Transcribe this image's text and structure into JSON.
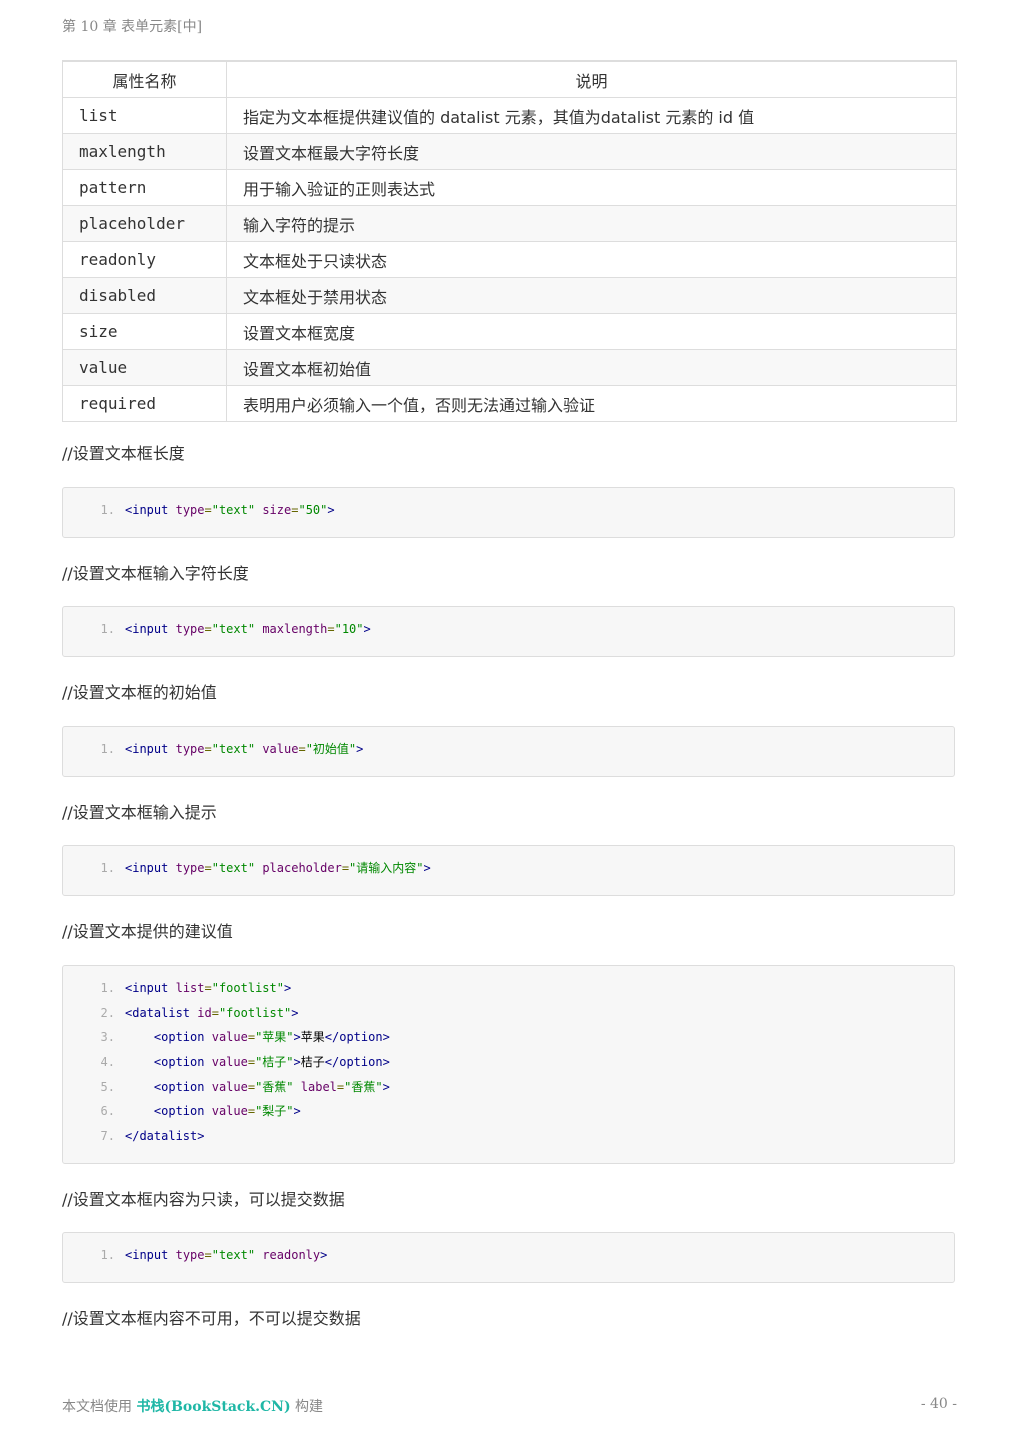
{
  "header": "第 10 章 表单元素[中]",
  "table": {
    "headers": [
      "属性名称",
      "说明"
    ],
    "rows": [
      [
        "list",
        "指定为文本框提供建议值的 datalist 元素，其值为datalist 元素的 id 值"
      ],
      [
        "maxlength",
        "设置文本框最大字符长度"
      ],
      [
        "pattern",
        "用于输入验证的正则表达式"
      ],
      [
        "placeholder",
        "输入字符的提示"
      ],
      [
        "readonly",
        "文本框处于只读状态"
      ],
      [
        "disabled",
        "文本框处于禁用状态"
      ],
      [
        "size",
        "设置文本框宽度"
      ],
      [
        "value",
        "设置文本框初始值"
      ],
      [
        "required",
        "表明用户必须输入一个值，否则无法通过输入验证"
      ]
    ]
  },
  "sections": [
    {
      "comment": "//设置文本框长度",
      "lines": [
        [
          [
            "tag",
            "<input"
          ],
          [
            "pln",
            " "
          ],
          [
            "atn",
            "type"
          ],
          [
            "pun",
            "="
          ],
          [
            "atv",
            "\"text\""
          ],
          [
            "pln",
            " "
          ],
          [
            "atn",
            "size"
          ],
          [
            "pun",
            "="
          ],
          [
            "atv",
            "\"50\""
          ],
          [
            "tag",
            ">"
          ]
        ]
      ]
    },
    {
      "comment": "//设置文本框输入字符长度",
      "lines": [
        [
          [
            "tag",
            "<input"
          ],
          [
            "pln",
            " "
          ],
          [
            "atn",
            "type"
          ],
          [
            "pun",
            "="
          ],
          [
            "atv",
            "\"text\""
          ],
          [
            "pln",
            " "
          ],
          [
            "atn",
            "maxlength"
          ],
          [
            "pun",
            "="
          ],
          [
            "atv",
            "\"10\""
          ],
          [
            "tag",
            ">"
          ]
        ]
      ]
    },
    {
      "comment": "//设置文本框的初始值",
      "lines": [
        [
          [
            "tag",
            "<input"
          ],
          [
            "pln",
            " "
          ],
          [
            "atn",
            "type"
          ],
          [
            "pun",
            "="
          ],
          [
            "atv",
            "\"text\""
          ],
          [
            "pln",
            " "
          ],
          [
            "atn",
            "value"
          ],
          [
            "pun",
            "="
          ],
          [
            "atv",
            "\"初始值\""
          ],
          [
            "tag",
            ">"
          ]
        ]
      ]
    },
    {
      "comment": "//设置文本框输入提示",
      "lines": [
        [
          [
            "tag",
            "<input"
          ],
          [
            "pln",
            " "
          ],
          [
            "atn",
            "type"
          ],
          [
            "pun",
            "="
          ],
          [
            "atv",
            "\"text\""
          ],
          [
            "pln",
            " "
          ],
          [
            "atn",
            "placeholder"
          ],
          [
            "pun",
            "="
          ],
          [
            "atv",
            "\"请输入内容\""
          ],
          [
            "tag",
            ">"
          ]
        ]
      ]
    },
    {
      "comment": "//设置文本提供的建议值",
      "lines": [
        [
          [
            "tag",
            "<input"
          ],
          [
            "pln",
            " "
          ],
          [
            "atn",
            "list"
          ],
          [
            "pun",
            "="
          ],
          [
            "atv",
            "\"footlist\""
          ],
          [
            "tag",
            ">"
          ]
        ],
        [
          [
            "tag",
            "<datalist"
          ],
          [
            "pln",
            " "
          ],
          [
            "atn",
            "id"
          ],
          [
            "pun",
            "="
          ],
          [
            "atv",
            "\"footlist\""
          ],
          [
            "tag",
            ">"
          ]
        ],
        [
          [
            "pln",
            "    "
          ],
          [
            "tag",
            "<option"
          ],
          [
            "pln",
            " "
          ],
          [
            "atn",
            "value"
          ],
          [
            "pun",
            "="
          ],
          [
            "atv",
            "\"苹果\""
          ],
          [
            "tag",
            ">"
          ],
          [
            "pln",
            "苹果"
          ],
          [
            "tag",
            "</option>"
          ]
        ],
        [
          [
            "pln",
            "    "
          ],
          [
            "tag",
            "<option"
          ],
          [
            "pln",
            " "
          ],
          [
            "atn",
            "value"
          ],
          [
            "pun",
            "="
          ],
          [
            "atv",
            "\"桔子\""
          ],
          [
            "tag",
            ">"
          ],
          [
            "pln",
            "桔子"
          ],
          [
            "tag",
            "</option>"
          ]
        ],
        [
          [
            "pln",
            "    "
          ],
          [
            "tag",
            "<option"
          ],
          [
            "pln",
            " "
          ],
          [
            "atn",
            "value"
          ],
          [
            "pun",
            "="
          ],
          [
            "atv",
            "\"香蕉\""
          ],
          [
            "pln",
            " "
          ],
          [
            "atn",
            "label"
          ],
          [
            "pun",
            "="
          ],
          [
            "atv",
            "\"香蕉\""
          ],
          [
            "tag",
            ">"
          ]
        ],
        [
          [
            "pln",
            "    "
          ],
          [
            "tag",
            "<option"
          ],
          [
            "pln",
            " "
          ],
          [
            "atn",
            "value"
          ],
          [
            "pun",
            "="
          ],
          [
            "atv",
            "\"梨子\""
          ],
          [
            "tag",
            ">"
          ]
        ],
        [
          [
            "tag",
            "</datalist>"
          ]
        ]
      ]
    },
    {
      "comment": "//设置文本框内容为只读，可以提交数据",
      "lines": [
        [
          [
            "tag",
            "<input"
          ],
          [
            "pln",
            " "
          ],
          [
            "atn",
            "type"
          ],
          [
            "pun",
            "="
          ],
          [
            "atv",
            "\"text\""
          ],
          [
            "pln",
            " "
          ],
          [
            "atn",
            "readonly"
          ],
          [
            "tag",
            ">"
          ]
        ]
      ]
    },
    {
      "comment": "//设置文本框内容不可用，不可以提交数据",
      "lines": []
    }
  ],
  "footer": {
    "prefix": "本文档使用 ",
    "brand": "书栈(BookStack.CN)",
    "suffix": " 构建",
    "page": "- 40 -"
  }
}
